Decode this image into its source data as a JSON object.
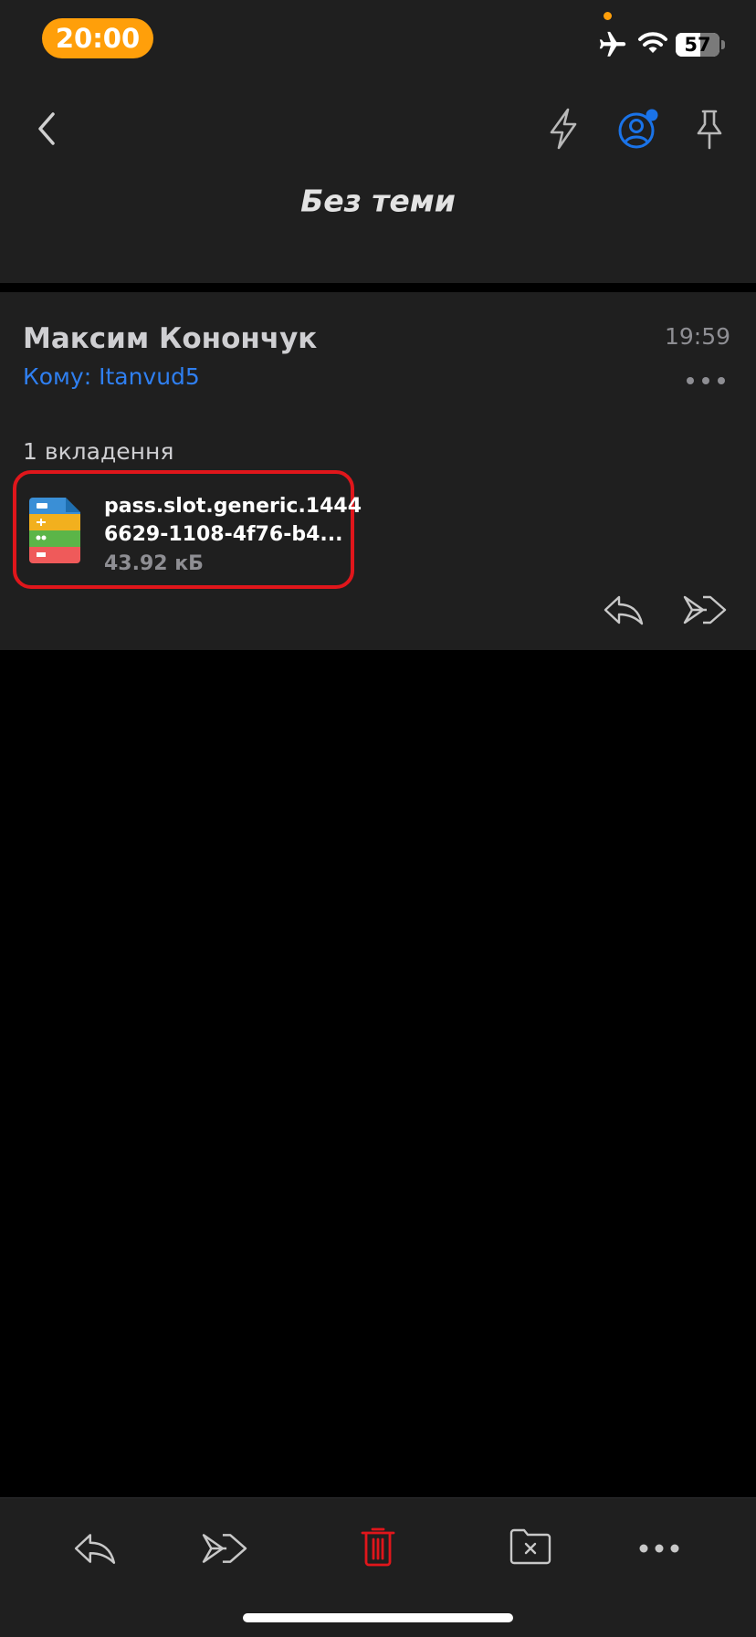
{
  "status_bar": {
    "time": "20:00",
    "battery_level": "57",
    "battery_fraction": 0.57,
    "icons": [
      "airplane-icon",
      "wifi-icon",
      "battery-icon"
    ]
  },
  "nav": {
    "back_icon": "chevron-left-icon",
    "actions": [
      "lightning-icon",
      "account-icon",
      "pin-icon"
    ],
    "account_badge_color": "#1a73e8"
  },
  "email": {
    "subject": "Без теми",
    "sender": "Максим Конончук",
    "recipient": "Кому: Itanvud5",
    "time": "19:59",
    "attachments_label": "1 вкладення",
    "attachment": {
      "name": "pass.slot.generic.1444\n6629-1108-4f76-b4...",
      "size": "43.92 кБ",
      "icon": "wallet-pass-file-icon"
    },
    "actions": [
      "reply-icon",
      "forward-icon"
    ]
  },
  "toolbar": {
    "items": [
      "reply-icon",
      "forward-icon",
      "trash-icon",
      "archive-folder-icon",
      "more-icon"
    ]
  },
  "colors": {
    "surface": "#1f1f1f",
    "background": "#000000",
    "accent_blue": "#2f7ff0",
    "highlight_red": "#e0161b",
    "time_pill_orange": "#ff9f0a",
    "secondary_text": "#8e8e93"
  }
}
